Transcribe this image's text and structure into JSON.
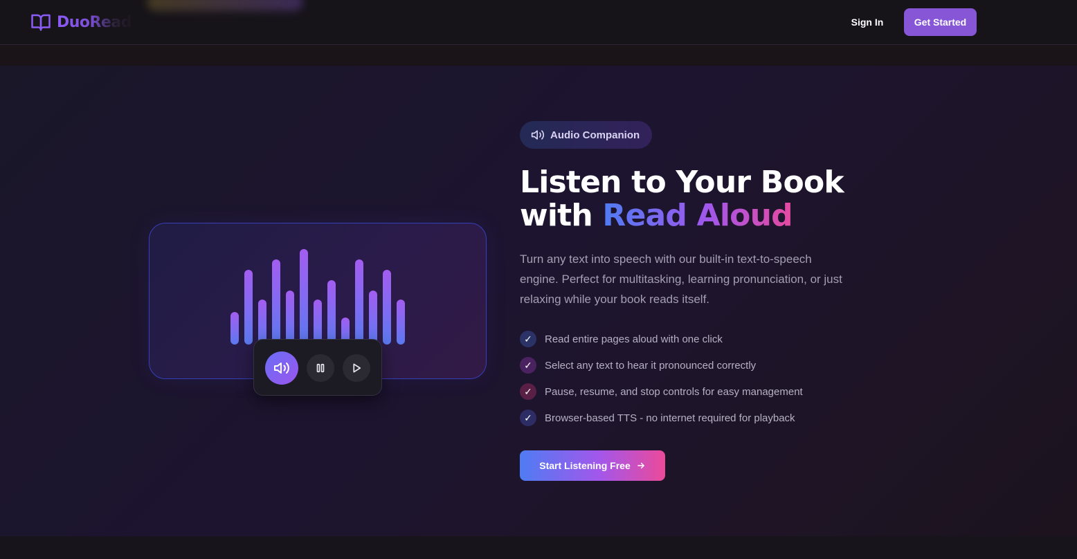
{
  "nav": {
    "brand": "DuoRead",
    "sign_in": "Sign In",
    "get_started": "Get Started"
  },
  "hero": {
    "badge": "Audio Companion",
    "headline_line1": "Listen to Your Book",
    "headline_with": "with",
    "headline_highlight": "Read Aloud",
    "description": "Turn any text into speech with our built-in text-to-speech engine. Perfect for multitasking, learning pronunciation, or just relaxing while your book reads itself.",
    "features": [
      {
        "text": "Read entire pages aloud with one click",
        "check_color": "#2b3266"
      },
      {
        "text": "Select any text to hear it pronounced correctly",
        "check_color": "#4b2260"
      },
      {
        "text": "Pause, resume, and stop controls for easy management",
        "check_color": "#5a1f45"
      },
      {
        "text": "Browser-based TTS - no internet required for playback",
        "check_color": "#2e2c64"
      }
    ],
    "cta": "Start Listening Free"
  },
  "waveform": {
    "levels": [
      0.31,
      0.72,
      0.43,
      0.82,
      0.52,
      0.92,
      0.43,
      0.62,
      0.26,
      0.82,
      0.52,
      0.72,
      0.43
    ]
  },
  "icons": {
    "brand": "book-open-icon",
    "badge": "speaker-icon",
    "main_control": "speaker-icon",
    "pause": "pause-icon",
    "play": "play-icon",
    "cta": "arrow-right-icon"
  },
  "colors": {
    "accent": "#8656d6",
    "gradient_start": "#4f7cf3",
    "gradient_mid": "#a057ec",
    "gradient_end": "#e64aa0"
  }
}
